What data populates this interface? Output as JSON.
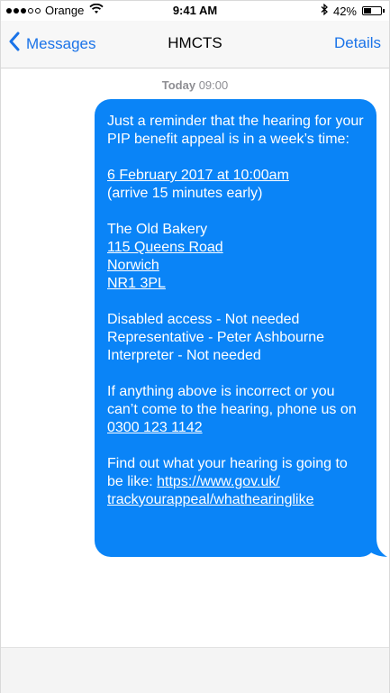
{
  "status": {
    "carrier": "Orange",
    "time": "9:41 AM",
    "battery": "42%",
    "battery_level": 0.42
  },
  "nav": {
    "back_label": "Messages",
    "title": "HMCTS",
    "details_label": "Details"
  },
  "conversation": {
    "date_label": "Today",
    "time_label": "09:00"
  },
  "message": {
    "intro": "Just a reminder that the hearing for your PIP benefit appeal is in a week’s time:",
    "date_link": "6 February 2017 at 10:00am",
    "arrive_note": "(arrive 15 minutes early)",
    "venue_name": "The Old Bakery",
    "address_line1": "115 Queens Road",
    "address_line2": "Norwich",
    "postcode": "NR1 3PL",
    "access": "Disabled access - Not needed",
    "representative": "Representative - Peter Ashbourne",
    "interpreter": "Interpreter - Not needed",
    "contact_text": "If anything above is incorrect or you can’t come to the hearing, phone us on ",
    "phone": "0300 123 1142",
    "find_out_text": "Find out what your hearing is going to be like: ",
    "link_part1": "https://www.gov.uk/",
    "link_part2": "trackyourappeal/whathearinglike"
  },
  "colors": {
    "bubble": "#0a84f7",
    "accent": "#1a73e8"
  }
}
